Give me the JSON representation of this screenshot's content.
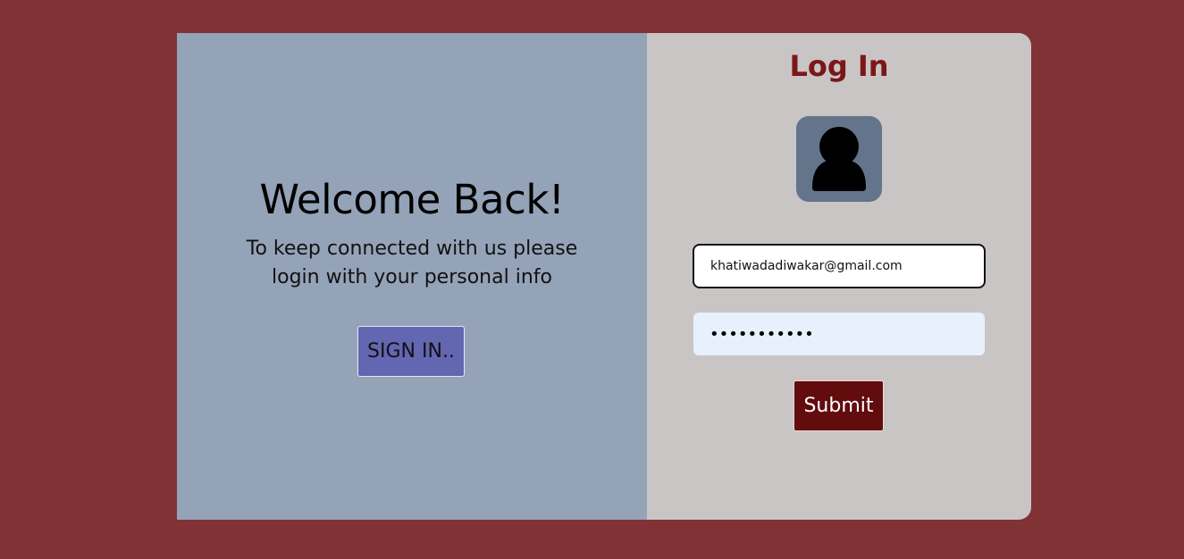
{
  "welcome": {
    "title": "Welcome Back!",
    "message": "To keep connected with us please login with your personal info",
    "signin_label": "SIGN IN.."
  },
  "login": {
    "title": "Log In",
    "avatar_icon": "user-icon",
    "email_value": "khatiwadadiwakar@gmail.com",
    "password_value": "abcdefghijk",
    "submit_label": "Submit"
  },
  "colors": {
    "background": "#813234",
    "left_panel": "#94a3b8",
    "right_panel": "#c9c5c4",
    "accent": "#7b1719",
    "signin_button": "#6366b1",
    "submit_button": "#620c0e",
    "avatar_bg": "#64748b",
    "password_bg": "#e8f0fe"
  }
}
